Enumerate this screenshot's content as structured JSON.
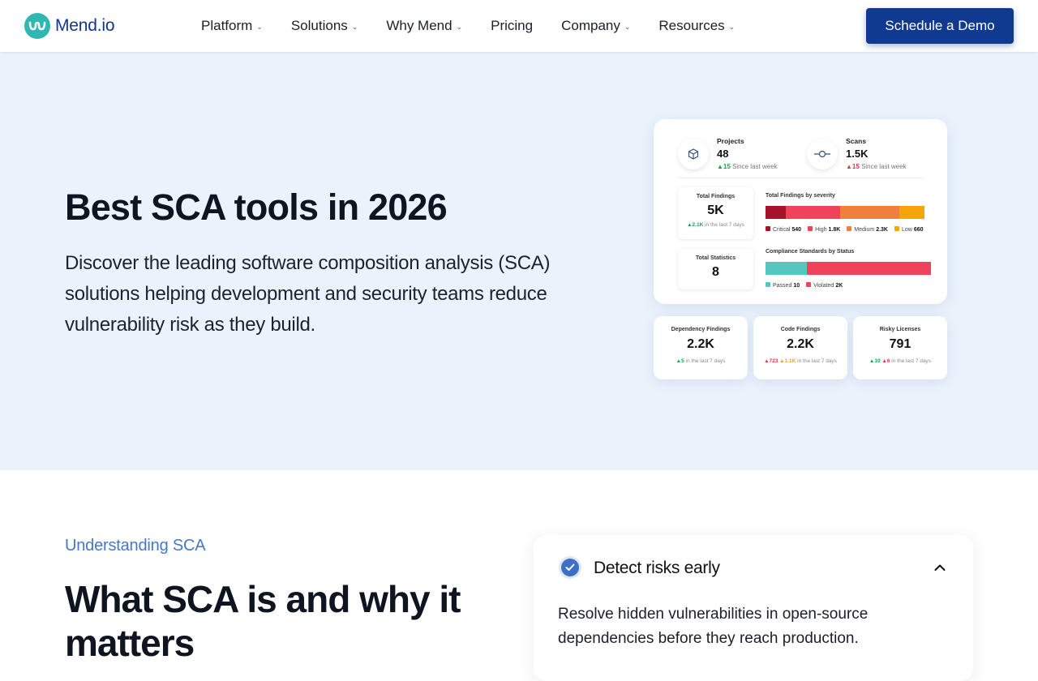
{
  "brand": {
    "name": "Mend.io",
    "colors": {
      "primary": "#0f3a8f",
      "teal": "#2fb7b2",
      "accent": "#4677c8"
    }
  },
  "nav": {
    "items": [
      {
        "label": "Platform",
        "has_dropdown": true
      },
      {
        "label": "Solutions",
        "has_dropdown": true
      },
      {
        "label": "Why Mend",
        "has_dropdown": true
      },
      {
        "label": "Pricing",
        "has_dropdown": false
      },
      {
        "label": "Company",
        "has_dropdown": true
      },
      {
        "label": "Resources",
        "has_dropdown": true
      }
    ],
    "cta": "Schedule a Demo"
  },
  "hero": {
    "title": "Best SCA tools in 2026",
    "subtitle": "Discover the leading software composition analysis (SCA) solutions helping development and security teams reduce vulnerability risk as they build."
  },
  "dashboard": {
    "projects": {
      "label": "Projects",
      "value": "48",
      "change": "15",
      "change_text": "Since last week",
      "direction": "up",
      "icon": "cube-icon"
    },
    "scans": {
      "label": "Scans",
      "value": "1.5K",
      "change": "15",
      "change_text": "Since last week",
      "direction": "up",
      "icon": "commit-icon"
    },
    "total_findings": {
      "label": "Total Findings",
      "value": "5K",
      "change": "2.1K",
      "change_text": "in the last 7 days"
    },
    "total_statistics": {
      "label": "Total Statistics",
      "value": "8"
    },
    "severity": {
      "title": "Total Findings by severity",
      "items": [
        {
          "label": "Critical",
          "value": "540",
          "color": "#a5122a",
          "fraction": 0.13
        },
        {
          "label": "High",
          "value": "1.8K",
          "color": "#f0425a",
          "fraction": 0.34
        },
        {
          "label": "Medium",
          "value": "2.3K",
          "color": "#f07f3c",
          "fraction": 0.37
        },
        {
          "label": "Low",
          "value": "660",
          "color": "#f5a50b",
          "fraction": 0.16
        }
      ]
    },
    "compliance": {
      "title": "Compliance Standards by Status",
      "items": [
        {
          "label": "Passed",
          "value": "10",
          "color": "#56c6bf",
          "fraction": 0.25
        },
        {
          "label": "Violated",
          "value": "2K",
          "color": "#f0425a",
          "fraction": 0.75
        }
      ]
    },
    "cards": [
      {
        "label": "Dependency Findings",
        "value": "2.2K",
        "changes": [
          {
            "value": "5",
            "tone": "g"
          }
        ],
        "change_text": "in the last 7 days"
      },
      {
        "label": "Code Findings",
        "value": "2.2K",
        "changes": [
          {
            "value": "723",
            "tone": "r"
          },
          {
            "value": "1.1K",
            "tone": "o"
          }
        ],
        "change_text": "in the last 7 days"
      },
      {
        "label": "Risky Licenses",
        "value": "791",
        "changes": [
          {
            "value": "10",
            "tone": "g"
          },
          {
            "value": "6",
            "tone": "r"
          }
        ],
        "change_text": "in the last 7 days"
      }
    ]
  },
  "section2": {
    "eyebrow": "Understanding SCA",
    "title": "What SCA is and why it matters",
    "accordion": {
      "title": "Detect risks early",
      "body": "Resolve hidden vulnerabilities in open-source dependencies before they reach production.",
      "expanded": true
    }
  }
}
